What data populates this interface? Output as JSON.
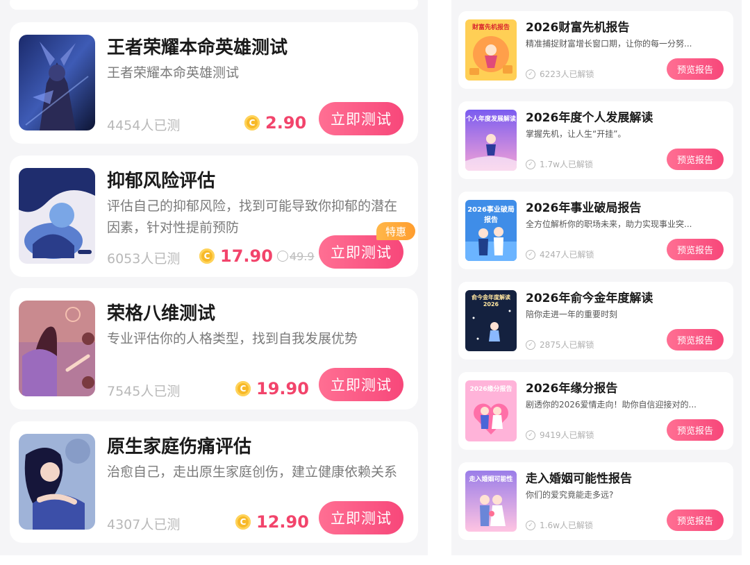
{
  "colors": {
    "accent": "#f7477a",
    "price": "#f2446b",
    "coin": "#f7b928",
    "badge": "#ff9d2e"
  },
  "left_list": [
    {
      "title": "王者荣耀本命英雄测试",
      "desc": "王者荣耀本命英雄测试",
      "count": "4454人已测",
      "coin_glyph": "C",
      "price": "2.90",
      "button": "立即测试"
    },
    {
      "title": "抑郁风险评估",
      "desc": "评估自己的抑郁风险，找到可能导致你抑郁的潜在因素，针对性提前预防",
      "count": "6053人已测",
      "coin_glyph": "C",
      "price": "17.90",
      "original_price": "49.9",
      "badge": "特惠",
      "button": "立即测试"
    },
    {
      "title": "荣格八维测试",
      "desc": "专业评估你的人格类型，找到自我发展优势",
      "count": "7545人已测",
      "coin_glyph": "C",
      "price": "19.90",
      "button": "立即测试"
    },
    {
      "title": "原生家庭伤痛评估",
      "desc": "治愈自己，走出原生家庭创伤，建立健康依赖关系",
      "count": "4307人已测",
      "coin_glyph": "C",
      "price": "12.90",
      "button": "立即测试"
    }
  ],
  "right_list": [
    {
      "title": "2026财富先机报告",
      "desc": "精准捕捉财富增长窗口期，让你的每一分努...",
      "count": "6223人已解锁",
      "button": "预览报告",
      "thumb_text": "财富先机报告"
    },
    {
      "title": "2026年度个人发展解读",
      "desc": "掌握先机，让人生“开挂”。",
      "count": "1.7w人已解锁",
      "button": "预览报告",
      "thumb_text": "个人年度发展解读"
    },
    {
      "title": "2026年事业破局报告",
      "desc": "全方位解析你的职场未来，助力实现事业突...",
      "count": "4247人已解锁",
      "button": "预览报告",
      "thumb_text": "2026事业破局报告"
    },
    {
      "title": "2026年俞今金年度解读",
      "desc": "陪你走进一年的重要时刻",
      "count": "2875人已解锁",
      "button": "预览报告",
      "thumb_text": "俞今金年度解读2026"
    },
    {
      "title": "2026年缘分报告",
      "desc": "剧透你的2026爱情走向！助你自信迎接对的...",
      "count": "9419人已解锁",
      "button": "预览报告",
      "thumb_text": "2026缘分报告"
    },
    {
      "title": "走入婚姻可能性报告",
      "desc": "你们的爱究竟能走多远?",
      "count": "1.6w人已解锁",
      "button": "预览报告",
      "thumb_text": "走入婚姻可能性"
    }
  ]
}
